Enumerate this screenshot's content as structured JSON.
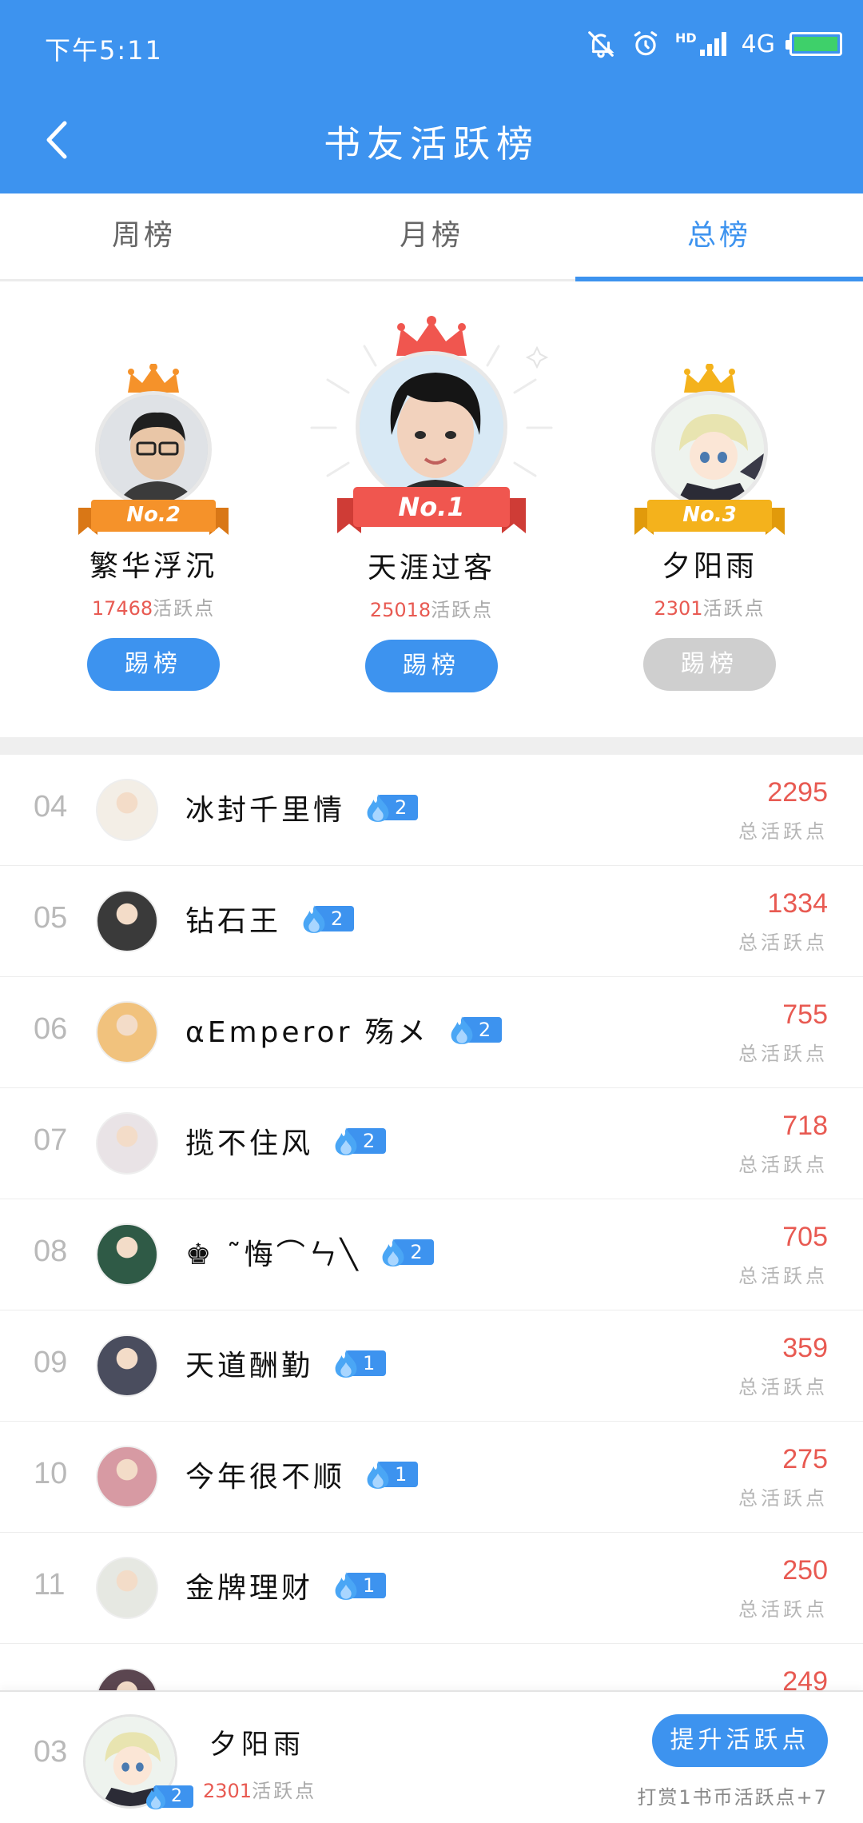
{
  "status_bar": {
    "time": "下午5:11",
    "network": "4G",
    "hd_label": "HD",
    "icons": [
      "bell-off-icon",
      "alarm-icon",
      "signal-icon",
      "battery-icon"
    ]
  },
  "nav": {
    "title": "书友活跃榜",
    "back_icon": "chevron-left-icon"
  },
  "tabs": [
    {
      "label": "周榜",
      "active": false
    },
    {
      "label": "月榜",
      "active": false
    },
    {
      "label": "总榜",
      "active": true
    }
  ],
  "podium": [
    {
      "rank_label": "No.2",
      "name": "繁华浮沉",
      "score": "17468",
      "unit": "活跃点",
      "button": "踢榜",
      "button_enabled": true,
      "ribbon_color": "#f5922a",
      "crown_color": "#f5922a"
    },
    {
      "rank_label": "No.1",
      "name": "天涯过客",
      "score": "25018",
      "unit": "活跃点",
      "button": "踢榜",
      "button_enabled": true,
      "ribbon_color": "#f0564f",
      "crown_color": "#f0564f"
    },
    {
      "rank_label": "No.3",
      "name": "夕阳雨",
      "score": "2301",
      "unit": "活跃点",
      "button": "踢榜",
      "button_enabled": false,
      "ribbon_color": "#f4b21c",
      "crown_color": "#f4b21c"
    }
  ],
  "list": [
    {
      "rank": "04",
      "name": "冰封千里情",
      "level": "2",
      "score": "2295",
      "unit": "总活跃点",
      "avatar_color": "#f3eee6"
    },
    {
      "rank": "05",
      "name": "钻石王",
      "level": "2",
      "score": "1334",
      "unit": "总活跃点",
      "avatar_color": "#3a3a3a"
    },
    {
      "rank": "06",
      "name": "αEmperor 殇メ",
      "level": "2",
      "score": "755",
      "unit": "总活跃点",
      "avatar_color": "#f1c27d"
    },
    {
      "rank": "07",
      "name": "揽不住风",
      "level": "2",
      "score": "718",
      "unit": "总活跃点",
      "avatar_color": "#e9e3e6"
    },
    {
      "rank": "08",
      "name": "♚ ˜悔⌒ㄣ╲",
      "level": "2",
      "score": "705",
      "unit": "总活跃点",
      "avatar_color": "#2f5a46"
    },
    {
      "rank": "09",
      "name": "天道酬勤",
      "level": "1",
      "score": "359",
      "unit": "总活跃点",
      "avatar_color": "#4a4d5e"
    },
    {
      "rank": "10",
      "name": "今年很不顺",
      "level": "1",
      "score": "275",
      "unit": "总活跃点",
      "avatar_color": "#d79aa3"
    },
    {
      "rank": "11",
      "name": "金牌理财",
      "level": "1",
      "score": "250",
      "unit": "总活跃点",
      "avatar_color": "#e6e8e2"
    },
    {
      "rank": "",
      "name": "",
      "level": "",
      "score": "249",
      "unit": "",
      "avatar_color": "#5b4650"
    }
  ],
  "me": {
    "rank": "03",
    "name": "夕阳雨",
    "level": "2",
    "score": "2301",
    "unit": "活跃点",
    "button": "提升活跃点",
    "hint": "打赏1书币活跃点+7"
  },
  "colors": {
    "primary": "#3d93ef",
    "score_red": "#e85a52",
    "disabled": "#cfcfcf"
  }
}
